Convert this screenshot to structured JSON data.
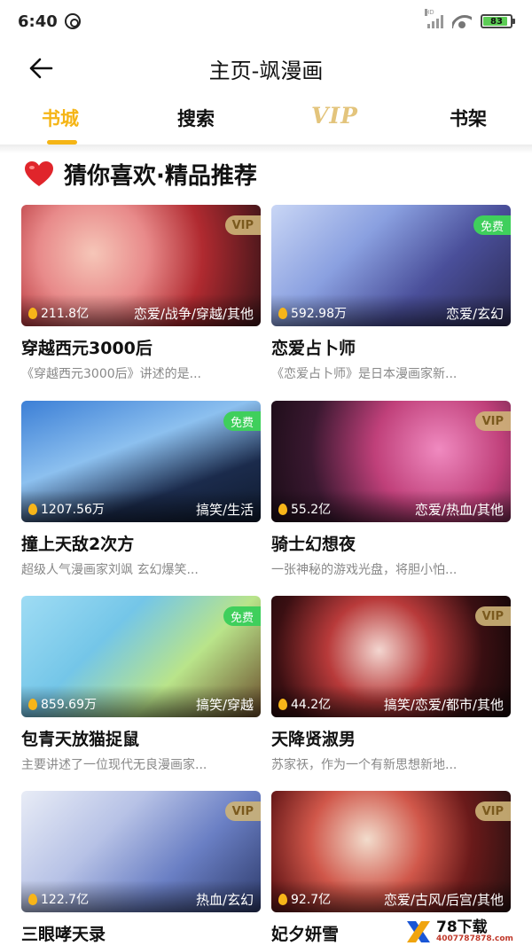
{
  "status_bar": {
    "time": "6:40",
    "network": "HD",
    "battery": "83",
    "battery_level": 0.83
  },
  "header": {
    "title": "主页-飒漫画"
  },
  "tabs": [
    {
      "label": "书城",
      "active": true
    },
    {
      "label": "搜索",
      "active": false
    },
    {
      "label": "VIP",
      "active": false
    },
    {
      "label": "书架",
      "active": false
    }
  ],
  "section": {
    "title": "猜你喜欢·精品推荐"
  },
  "comics": [
    {
      "name": "穿越西元3000后",
      "desc": "《穿越西元3000后》讲述的是...",
      "popularity": "211.8亿",
      "tags": "恋爱/战争/穿越/其他",
      "badge": "VIP"
    },
    {
      "name": "恋爱占卜师",
      "desc": "《恋爱占卜师》是日本漫画家新...",
      "popularity": "592.98万",
      "tags": "恋爱/玄幻",
      "badge": "免费"
    },
    {
      "name": "撞上天敌2次方",
      "desc": "超级人气漫画家刘飒 玄幻爆笑...",
      "popularity": "1207.56万",
      "tags": "搞笑/生活",
      "badge": "免费"
    },
    {
      "name": "骑士幻想夜",
      "desc": "一张神秘的游戏光盘，将胆小怕...",
      "popularity": "55.2亿",
      "tags": "恋爱/热血/其他",
      "badge": "VIP"
    },
    {
      "name": "包青天放猫捉鼠",
      "desc": "主要讲述了一位现代无良漫画家...",
      "popularity": "859.69万",
      "tags": "搞笑/穿越",
      "badge": "免费"
    },
    {
      "name": "天降贤淑男",
      "desc": "苏家祆，作为一个有新思想新地...",
      "popularity": "44.2亿",
      "tags": "搞笑/恋爱/都市/其他",
      "badge": "VIP"
    },
    {
      "name": "三眼哮天录",
      "desc": "",
      "popularity": "122.7亿",
      "tags": "热血/玄幻",
      "badge": "VIP"
    },
    {
      "name": "妃夕妍雪",
      "desc": "",
      "popularity": "92.7亿",
      "tags": "恋爱/古风/后宫/其他",
      "badge": "VIP"
    }
  ],
  "watermark": {
    "brand": "78下载",
    "url": "4007787878.com"
  },
  "colors": {
    "accent": "#f5b516",
    "free_badge": "#3fcf5c",
    "vip_badge": "#cdb478",
    "heart": "#e0252b"
  }
}
